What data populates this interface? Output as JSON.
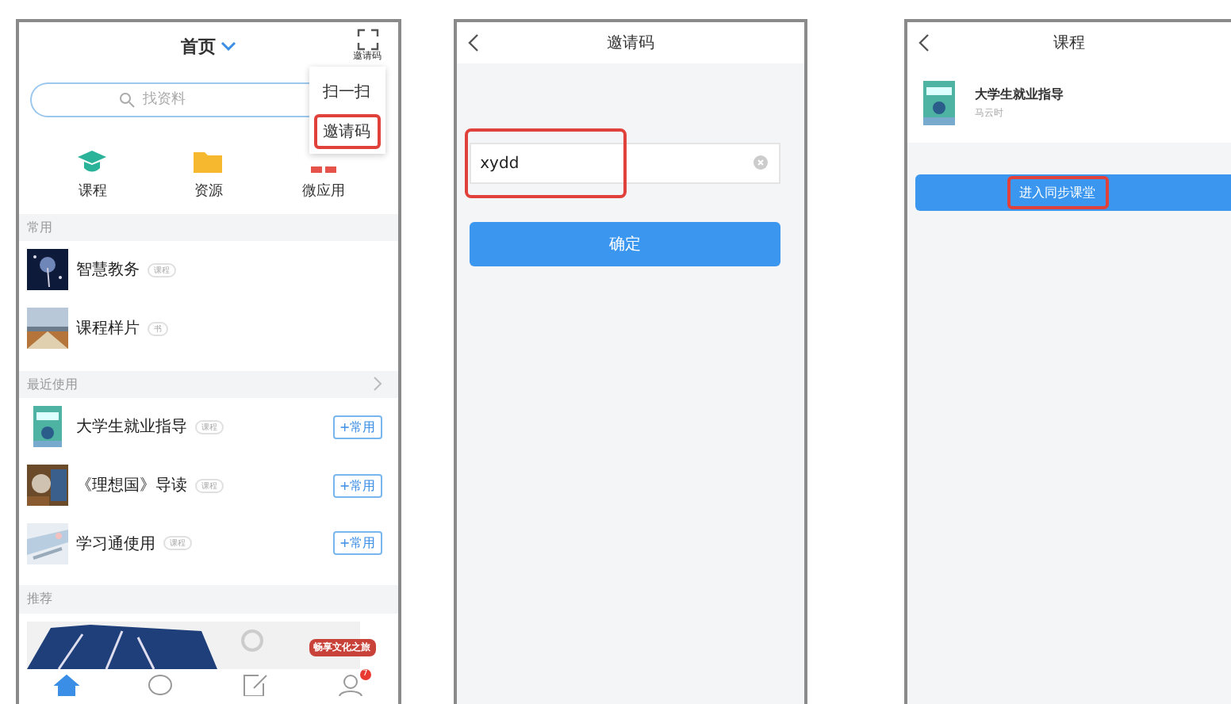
{
  "home_screen": {
    "title": "首页",
    "scan_label": "邀请码",
    "popup_menu": [
      {
        "label": "扫一扫",
        "highlighted": false
      },
      {
        "label": "邀请码",
        "highlighted": true
      }
    ],
    "search": {
      "placeholder": "找资料"
    },
    "shortcuts": [
      {
        "label": "课程",
        "kind": "cap"
      },
      {
        "label": "资源",
        "kind": "folder"
      },
      {
        "label": "微应用",
        "kind": "apps"
      }
    ],
    "sections": [
      {
        "title": "常用",
        "more": false,
        "items": [
          {
            "name": "智慧教务",
            "tag": "课程"
          },
          {
            "name": "课程样片",
            "tag": "书"
          }
        ]
      },
      {
        "title": "最近使用",
        "more": true,
        "items": [
          {
            "name": "大学生就业指导",
            "tag": "课程",
            "add_button": "+常用"
          },
          {
            "name": "《理想国》导读",
            "tag": "课程",
            "add_button": "+常用"
          },
          {
            "name": "学习通使用",
            "tag": "课程",
            "add_button": "+常用"
          }
        ]
      },
      {
        "title": "推荐",
        "more": false
      }
    ],
    "banner_text": "畅享文化之旅",
    "tab_bar": [
      {
        "kind": "home",
        "selected": true
      },
      {
        "kind": "chat",
        "selected": false
      },
      {
        "kind": "note",
        "selected": false
      },
      {
        "kind": "profile",
        "selected": false,
        "badge": "7"
      }
    ]
  },
  "invite_screen": {
    "title": "邀请码",
    "code": {
      "value": "xydd",
      "highlighted": true
    },
    "confirm_button": "确定"
  },
  "course_screen": {
    "title": "课程",
    "course": {
      "name": "大学生就业指导",
      "teacher": "马云时"
    },
    "enter_button": {
      "label": "进入同步课堂",
      "highlighted": true
    }
  }
}
